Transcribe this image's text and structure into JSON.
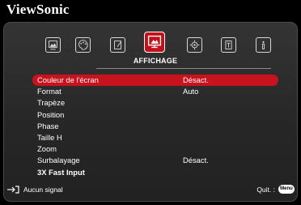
{
  "brand": "ViewSonic",
  "tabs": [
    {
      "name": "image-icon"
    },
    {
      "name": "color-palette-icon"
    },
    {
      "name": "adjust-icon"
    },
    {
      "name": "display-icon",
      "active": true
    },
    {
      "name": "settings-icon"
    },
    {
      "name": "advanced-icon"
    },
    {
      "name": "info-icon"
    }
  ],
  "active_tab_label": "AFFICHAGE",
  "menu_rows": [
    {
      "label": "Couleur de l'écran",
      "value": "Désact.",
      "selected": true
    },
    {
      "label": "Format",
      "value": "Auto"
    },
    {
      "label": "Trapèze",
      "value": ""
    },
    {
      "label": "Position",
      "value": ""
    },
    {
      "label": "Phase",
      "value": ""
    },
    {
      "label": "Taille H",
      "value": ""
    },
    {
      "label": "Zoom",
      "value": ""
    },
    {
      "label": "Surbalayage",
      "value": "Désact."
    },
    {
      "label": "3X Fast Input",
      "value": "",
      "bold": true
    }
  ],
  "footer": {
    "signal_text": "Aucun signal",
    "quit_text": "Quit. :",
    "menu_button": "Menu"
  },
  "colors": {
    "accent": "#c8121e",
    "panel": "#2c2c2c"
  }
}
